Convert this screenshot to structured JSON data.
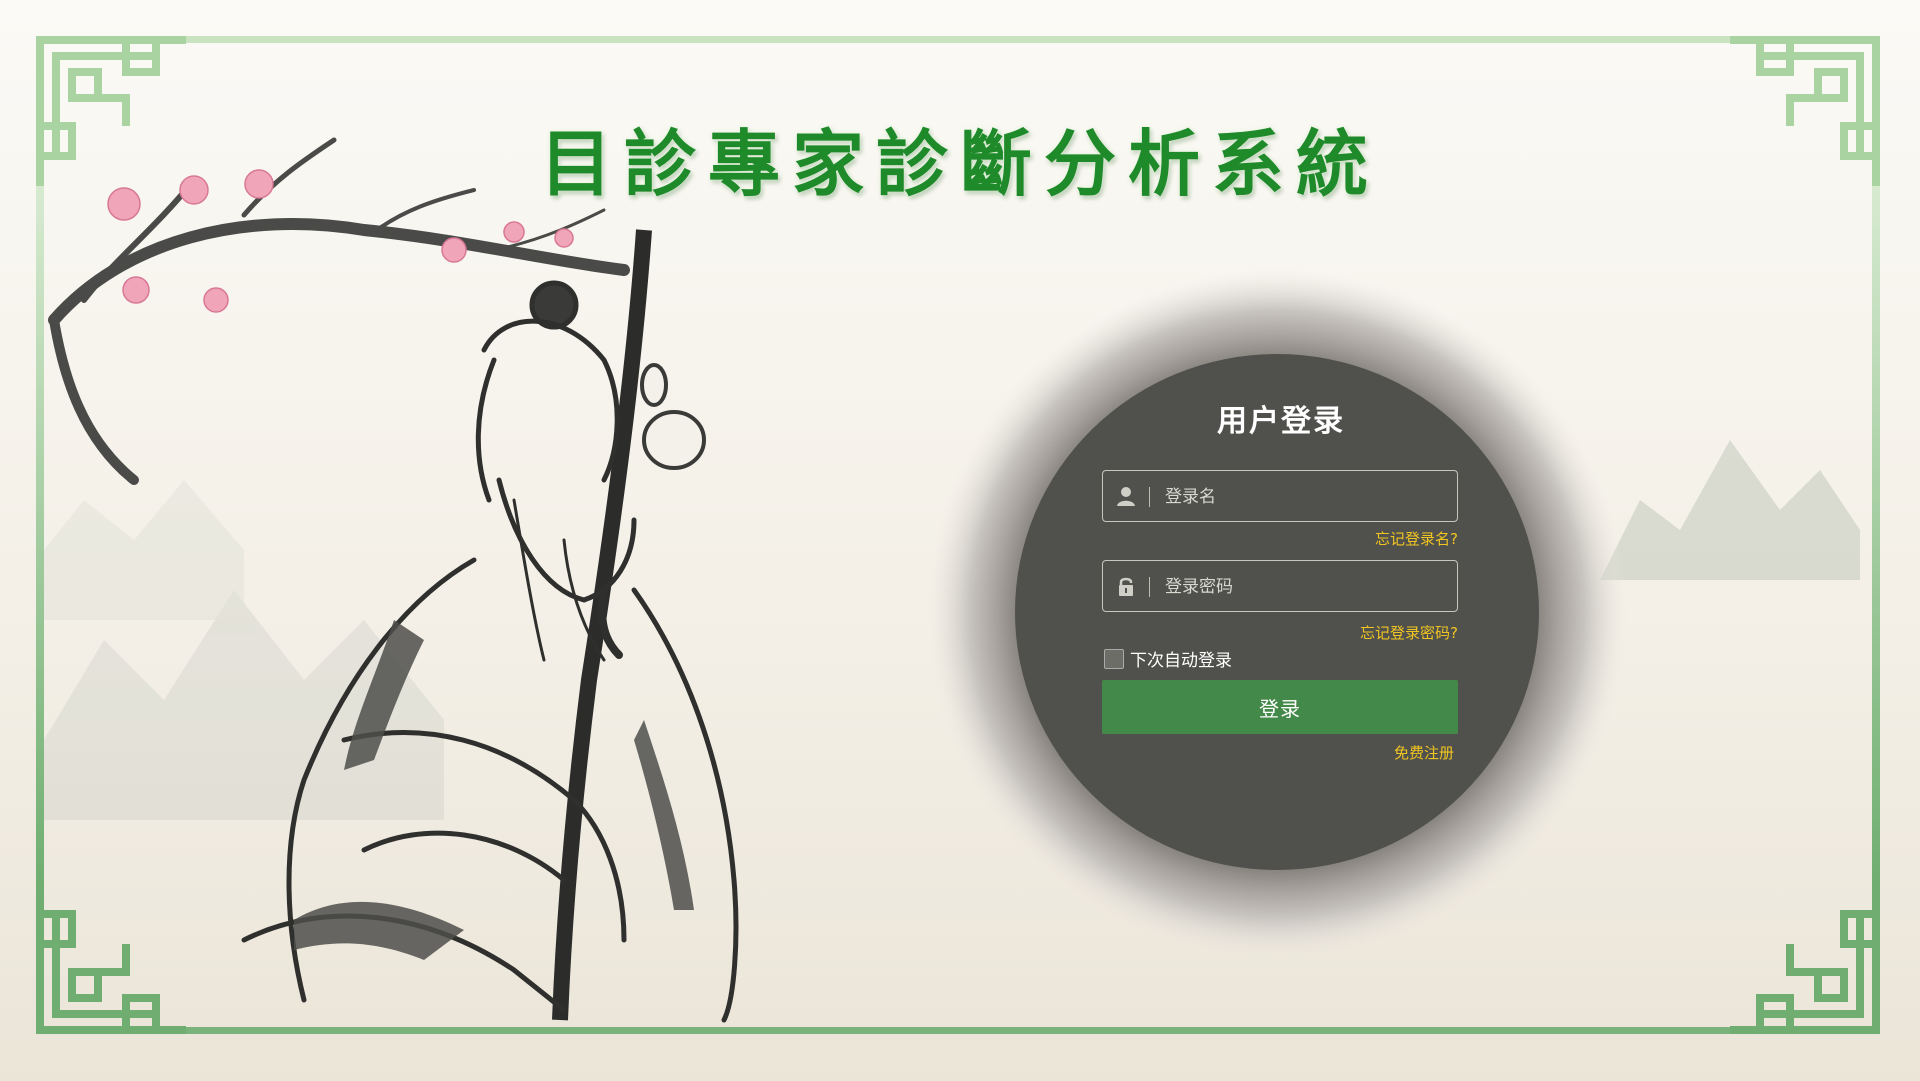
{
  "title": "目診專家診斷分析系統",
  "login": {
    "heading": "用户登录",
    "username_placeholder": "登录名",
    "password_placeholder": "登录密码",
    "forgot_username": "忘记登录名?",
    "forgot_password": "忘记登录密码?",
    "remember_label": "下次自动登录",
    "submit_label": "登录",
    "register_label": "免费注册"
  },
  "icons": {
    "username": "user-icon",
    "password": "lock-icon"
  },
  "colors": {
    "title": "#1f8a2a",
    "frame": "#7ab27c",
    "button": "#438a4a",
    "link": "#f1c521",
    "panel": "#50514c"
  }
}
